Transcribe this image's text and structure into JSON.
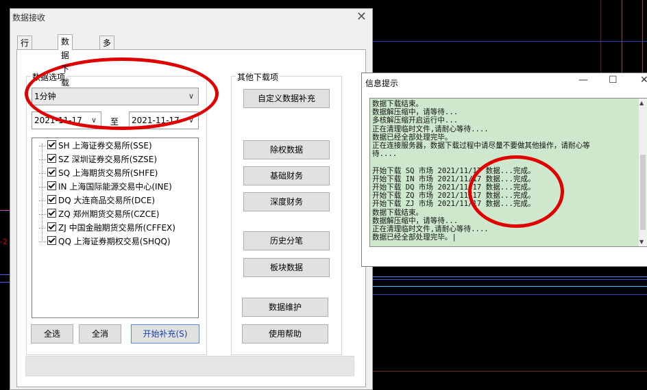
{
  "main_window": {
    "title": "数据接收",
    "close_symbol": "✕",
    "tabs": [
      {
        "label": "行情连接",
        "active": false
      },
      {
        "label": "数据下载",
        "active": true
      },
      {
        "label": "多档订阅",
        "active": false
      }
    ],
    "data_options": {
      "group_label": "数据选项",
      "period_value": "1分钟",
      "start_date": "2021-11-17",
      "to_label": "至",
      "end_date": "2021-11-17",
      "markets": [
        {
          "label": "SH 上海证券交易所(SSE)",
          "checked": true
        },
        {
          "label": "SZ 深圳证券交易所(SZSE)",
          "checked": true
        },
        {
          "label": "SQ 上海期货交易所(SHFE)",
          "checked": true
        },
        {
          "label": "IN 上海国际能源交易中心(INE)",
          "checked": true
        },
        {
          "label": "DQ 大连商品交易所(DCE)",
          "checked": true
        },
        {
          "label": "ZQ 郑州期货交易所(CZCE)",
          "checked": true
        },
        {
          "label": "ZJ 中国金融期货交易所(CFFEX)",
          "checked": true
        },
        {
          "label": "QQ 上海证券期权交易(SHQQ)",
          "checked": true
        }
      ],
      "select_all": "全选",
      "deselect_all": "全消",
      "start_fill": "开始补充(S)"
    },
    "other_downloads": {
      "group_label": "其他下载项",
      "buttons": [
        "自定义数据补充",
        "除权数据",
        "基础财务",
        "深度财务",
        "历史分笔",
        "板块数据",
        "数据维护",
        "使用帮助"
      ]
    }
  },
  "info_window": {
    "title": "信息提示",
    "minimize_symbol": "—",
    "maximize_symbol": "☐",
    "close_symbol": "✕",
    "lines": [
      "数据下载结束。",
      "数据解压缩中，请等待...",
      "多核解压缩开启运行中...",
      "正在清理临时文件,请耐心等待....",
      "数据已经全部处理完毕。",
      "正在连接服务器，数据下载过程中请尽量不要做其他操作，请耐心等",
      "待....",
      "",
      "开始下载 SQ 市场 2021/11/17 数据...完成。",
      "开始下载 IN 市场 2021/11/17 数据...完成。",
      "开始下载 DQ 市场 2021/11/17 数据...完成。",
      "开始下载 ZQ 市场 2021/11/17 数据...完成。",
      "开始下载 ZJ 市场 2021/11/17 数据...完成。",
      "数据下载结束。",
      "数据解压缩中，请等待...",
      "正在清理临时文件,请耐心等待....",
      "数据已经全部处理完毕。|"
    ]
  },
  "background": {
    "edge_label": "-2"
  },
  "colors": {
    "annotation": "#e00000",
    "log_background": "#cde8cd",
    "background": "#000000"
  }
}
